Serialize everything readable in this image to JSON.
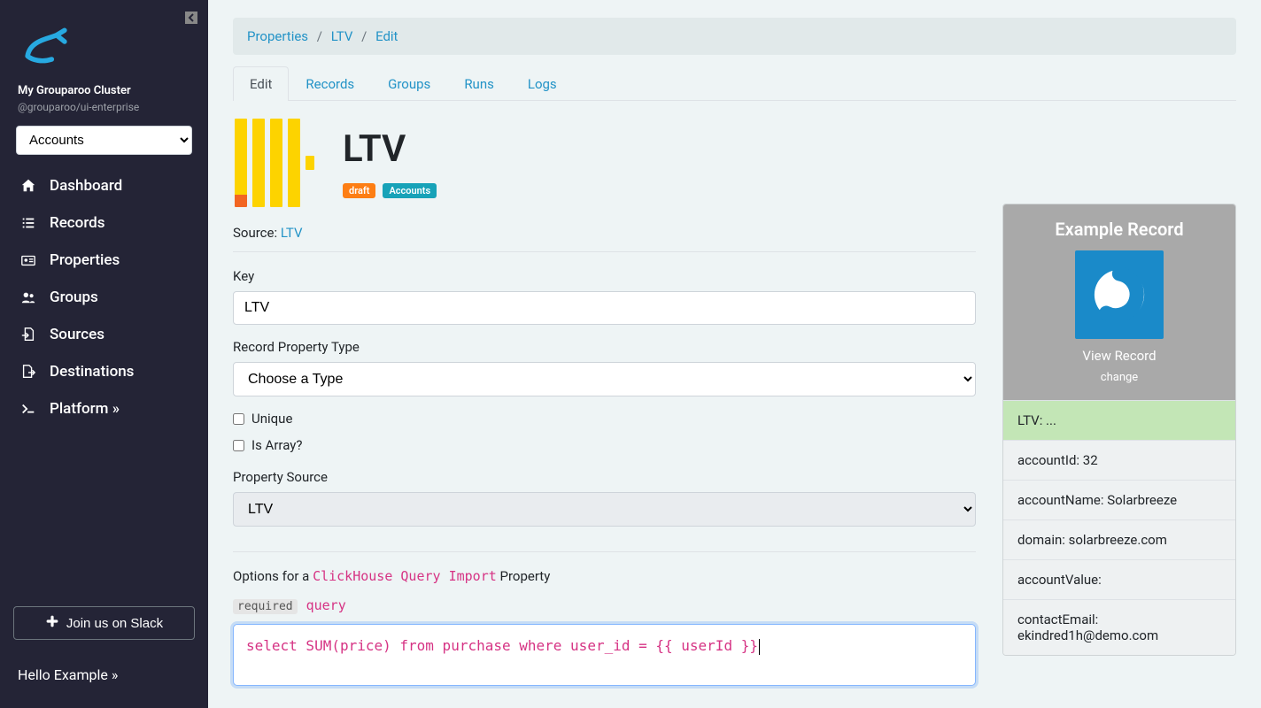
{
  "sidebar": {
    "cluster_name": "My Grouparoo Cluster",
    "cluster_sub": "@grouparoo/ui-enterprise",
    "model_selected": "Accounts",
    "nav": [
      {
        "icon": "home",
        "label": "Dashboard"
      },
      {
        "icon": "list",
        "label": "Records"
      },
      {
        "icon": "id-card",
        "label": "Properties"
      },
      {
        "icon": "users",
        "label": "Groups"
      },
      {
        "icon": "file-import",
        "label": "Sources"
      },
      {
        "icon": "file-export",
        "label": "Destinations"
      },
      {
        "icon": "terminal",
        "label": "Platform »"
      }
    ],
    "slack_label": "Join us on Slack",
    "hello_user": "Hello Example »"
  },
  "breadcrumb": {
    "parts": [
      "Properties",
      "LTV",
      "Edit"
    ]
  },
  "tabs": [
    "Edit",
    "Records",
    "Groups",
    "Runs",
    "Logs"
  ],
  "active_tab": "Edit",
  "property": {
    "title": "LTV",
    "badges": [
      {
        "text": "draft",
        "variant": "orange"
      },
      {
        "text": "Accounts",
        "variant": "blue"
      }
    ],
    "source_label": "Source",
    "source_value": "LTV"
  },
  "form": {
    "key_label": "Key",
    "key_value": "LTV",
    "type_label": "Record Property Type",
    "type_placeholder": "Choose a Type",
    "unique_label": "Unique",
    "isarray_label": "Is Array?",
    "propsource_label": "Property Source",
    "propsource_value": "LTV",
    "options_prefix": "Options for a ",
    "options_code": "ClickHouse Query Import",
    "options_suffix": " Property",
    "required_label": "required",
    "query_label": "query",
    "query_value": "select SUM(price) from purchase where user_id = {{ userId }}"
  },
  "example": {
    "title": "Example Record",
    "view_record": "View Record",
    "change_label": "change",
    "rows": [
      {
        "key": "LTV",
        "value": "...",
        "highlight": true
      },
      {
        "key": "accountId",
        "value": "32",
        "highlight": false
      },
      {
        "key": "accountName",
        "value": "Solarbreeze",
        "highlight": false
      },
      {
        "key": "domain",
        "value": "solarbreeze.com",
        "highlight": false
      },
      {
        "key": "accountValue",
        "value": "",
        "highlight": false
      },
      {
        "key": "contactEmail",
        "value": "ekindred1h@demo.com",
        "highlight": false
      }
    ]
  }
}
